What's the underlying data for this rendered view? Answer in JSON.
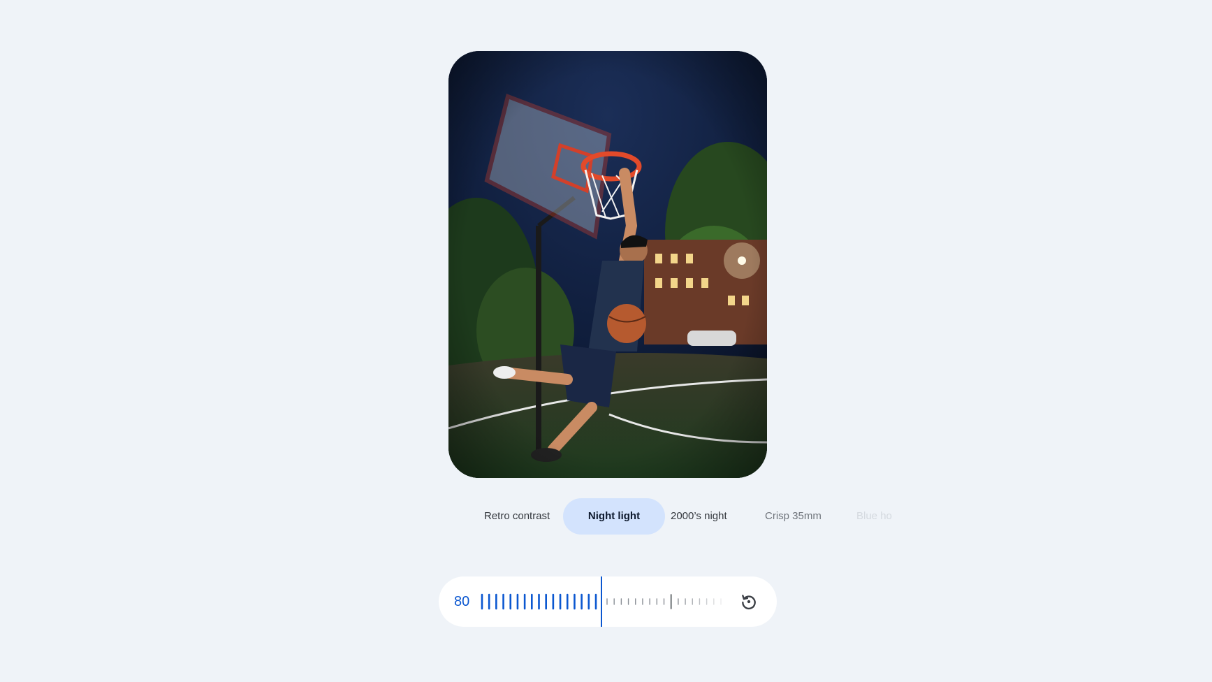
{
  "photo": {
    "subject": "basketball-dunk-photo"
  },
  "filters": {
    "items": [
      {
        "label": "Retro contrast"
      },
      {
        "label": "Night light"
      },
      {
        "label": "2000’s night"
      },
      {
        "label": "Crisp 35mm"
      },
      {
        "label": "Blue ho"
      }
    ],
    "selected": "Night light"
  },
  "slider": {
    "value": "80",
    "level_fraction": 0.5,
    "icon": "reset-icon"
  },
  "colors": {
    "background": "#eff3f8",
    "accent": "#0b57d0",
    "chip_selected_bg": "#d3e3fd",
    "pill_bg": "#ffffff"
  }
}
